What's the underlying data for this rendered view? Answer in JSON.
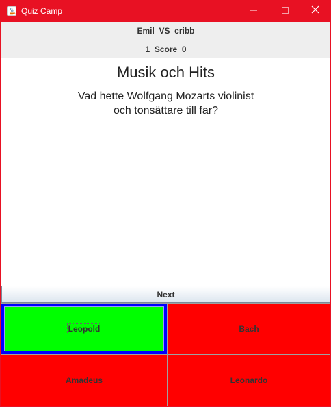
{
  "window": {
    "title": "Quiz Camp",
    "accent_color": "#e81123",
    "controls": [
      "minimize-icon",
      "maximize-icon",
      "close-icon"
    ]
  },
  "header": {
    "player1": "Emil",
    "vs": "VS",
    "player2": "cribb",
    "score1": "1",
    "score_label": "Score",
    "score2": "0"
  },
  "question": {
    "category": "Musik och Hits",
    "line1": "Vad hette Wolfgang Mozarts violinist",
    "line2": "och tonsättare till far?"
  },
  "next_button": {
    "label": "Next"
  },
  "answers": [
    {
      "label": "Leopold",
      "state": "correct",
      "color": "#00ff00",
      "selected": true
    },
    {
      "label": "Bach",
      "state": "wrong",
      "color": "#ff0000",
      "selected": false
    },
    {
      "label": "Amadeus",
      "state": "wrong",
      "color": "#ff0000",
      "selected": false
    },
    {
      "label": "Leonardo",
      "state": "wrong",
      "color": "#ff0000",
      "selected": false
    }
  ],
  "colors": {
    "correct": "#00ff00",
    "wrong": "#ff0000",
    "selection_border": "#0000ff"
  }
}
